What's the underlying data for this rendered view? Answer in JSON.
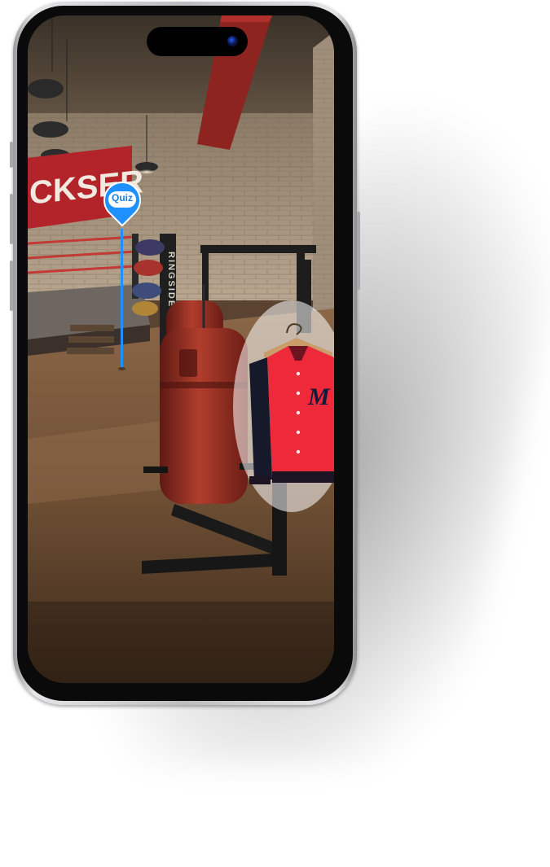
{
  "device": {
    "type": "phone"
  },
  "scene": {
    "banner_text": "CKSER",
    "post_text": "RINGSIDE",
    "jacket_logo": "M"
  },
  "hotspots": {
    "quiz_label": "Quiz"
  },
  "colors": {
    "quiz_blue": "#1e90ff",
    "banner_red": "#b3242a",
    "jacket_red": "#ee2a3a"
  }
}
